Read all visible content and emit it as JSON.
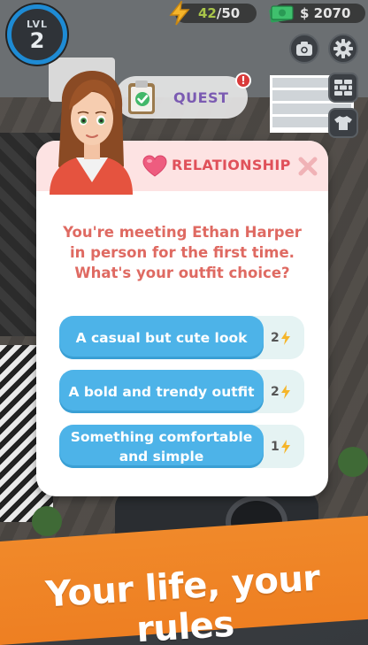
{
  "hud": {
    "level_label": "LVL",
    "level_value": "2",
    "energy_current": "42",
    "energy_max": "/50",
    "money": "$ 2070"
  },
  "quest": {
    "label": "QUEST",
    "alert_badge": "!"
  },
  "dialog": {
    "title": "RELATIONSHIP",
    "question": "You're meeting Ethan Harper in person for the first time. What's your outfit choice?",
    "choices": [
      {
        "label": "A casual but cute look",
        "cost": "2"
      },
      {
        "label": "A bold and trendy outfit",
        "cost": "2"
      },
      {
        "label": "Something comfortable and simple",
        "cost": "1"
      }
    ]
  },
  "banner": {
    "text": "Your life, your rules"
  },
  "icons": {
    "energy": "lightning-bolt-icon",
    "money": "cash-icon",
    "quest": "clipboard-check-icon",
    "relationship": "heart-icon",
    "close": "close-icon",
    "camera": "camera-icon",
    "settings": "gear-icon",
    "build": "brick-wall-icon",
    "wardrobe": "shirt-icon"
  },
  "colors": {
    "accent_blue": "#4db3e8",
    "relationship_red": "#e0515a",
    "banner_orange": "#ee7f22",
    "energy_green": "#a9c54a"
  }
}
